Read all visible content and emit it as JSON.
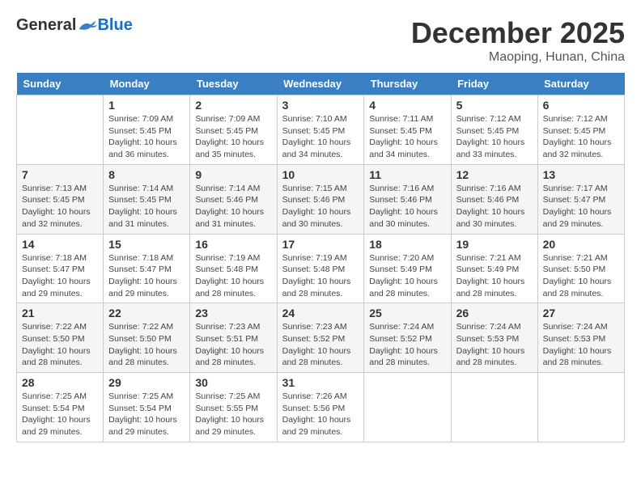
{
  "logo": {
    "general": "General",
    "blue": "Blue"
  },
  "title": {
    "month": "December 2025",
    "location": "Maoping, Hunan, China"
  },
  "weekdays": [
    "Sunday",
    "Monday",
    "Tuesday",
    "Wednesday",
    "Thursday",
    "Friday",
    "Saturday"
  ],
  "weeks": [
    [
      {
        "day": "",
        "sunrise": "",
        "sunset": "",
        "daylight": ""
      },
      {
        "day": "1",
        "sunrise": "Sunrise: 7:09 AM",
        "sunset": "Sunset: 5:45 PM",
        "daylight": "Daylight: 10 hours and 36 minutes."
      },
      {
        "day": "2",
        "sunrise": "Sunrise: 7:09 AM",
        "sunset": "Sunset: 5:45 PM",
        "daylight": "Daylight: 10 hours and 35 minutes."
      },
      {
        "day": "3",
        "sunrise": "Sunrise: 7:10 AM",
        "sunset": "Sunset: 5:45 PM",
        "daylight": "Daylight: 10 hours and 34 minutes."
      },
      {
        "day": "4",
        "sunrise": "Sunrise: 7:11 AM",
        "sunset": "Sunset: 5:45 PM",
        "daylight": "Daylight: 10 hours and 34 minutes."
      },
      {
        "day": "5",
        "sunrise": "Sunrise: 7:12 AM",
        "sunset": "Sunset: 5:45 PM",
        "daylight": "Daylight: 10 hours and 33 minutes."
      },
      {
        "day": "6",
        "sunrise": "Sunrise: 7:12 AM",
        "sunset": "Sunset: 5:45 PM",
        "daylight": "Daylight: 10 hours and 32 minutes."
      }
    ],
    [
      {
        "day": "7",
        "sunrise": "Sunrise: 7:13 AM",
        "sunset": "Sunset: 5:45 PM",
        "daylight": "Daylight: 10 hours and 32 minutes."
      },
      {
        "day": "8",
        "sunrise": "Sunrise: 7:14 AM",
        "sunset": "Sunset: 5:45 PM",
        "daylight": "Daylight: 10 hours and 31 minutes."
      },
      {
        "day": "9",
        "sunrise": "Sunrise: 7:14 AM",
        "sunset": "Sunset: 5:46 PM",
        "daylight": "Daylight: 10 hours and 31 minutes."
      },
      {
        "day": "10",
        "sunrise": "Sunrise: 7:15 AM",
        "sunset": "Sunset: 5:46 PM",
        "daylight": "Daylight: 10 hours and 30 minutes."
      },
      {
        "day": "11",
        "sunrise": "Sunrise: 7:16 AM",
        "sunset": "Sunset: 5:46 PM",
        "daylight": "Daylight: 10 hours and 30 minutes."
      },
      {
        "day": "12",
        "sunrise": "Sunrise: 7:16 AM",
        "sunset": "Sunset: 5:46 PM",
        "daylight": "Daylight: 10 hours and 30 minutes."
      },
      {
        "day": "13",
        "sunrise": "Sunrise: 7:17 AM",
        "sunset": "Sunset: 5:47 PM",
        "daylight": "Daylight: 10 hours and 29 minutes."
      }
    ],
    [
      {
        "day": "14",
        "sunrise": "Sunrise: 7:18 AM",
        "sunset": "Sunset: 5:47 PM",
        "daylight": "Daylight: 10 hours and 29 minutes."
      },
      {
        "day": "15",
        "sunrise": "Sunrise: 7:18 AM",
        "sunset": "Sunset: 5:47 PM",
        "daylight": "Daylight: 10 hours and 29 minutes."
      },
      {
        "day": "16",
        "sunrise": "Sunrise: 7:19 AM",
        "sunset": "Sunset: 5:48 PM",
        "daylight": "Daylight: 10 hours and 28 minutes."
      },
      {
        "day": "17",
        "sunrise": "Sunrise: 7:19 AM",
        "sunset": "Sunset: 5:48 PM",
        "daylight": "Daylight: 10 hours and 28 minutes."
      },
      {
        "day": "18",
        "sunrise": "Sunrise: 7:20 AM",
        "sunset": "Sunset: 5:49 PM",
        "daylight": "Daylight: 10 hours and 28 minutes."
      },
      {
        "day": "19",
        "sunrise": "Sunrise: 7:21 AM",
        "sunset": "Sunset: 5:49 PM",
        "daylight": "Daylight: 10 hours and 28 minutes."
      },
      {
        "day": "20",
        "sunrise": "Sunrise: 7:21 AM",
        "sunset": "Sunset: 5:50 PM",
        "daylight": "Daylight: 10 hours and 28 minutes."
      }
    ],
    [
      {
        "day": "21",
        "sunrise": "Sunrise: 7:22 AM",
        "sunset": "Sunset: 5:50 PM",
        "daylight": "Daylight: 10 hours and 28 minutes."
      },
      {
        "day": "22",
        "sunrise": "Sunrise: 7:22 AM",
        "sunset": "Sunset: 5:50 PM",
        "daylight": "Daylight: 10 hours and 28 minutes."
      },
      {
        "day": "23",
        "sunrise": "Sunrise: 7:23 AM",
        "sunset": "Sunset: 5:51 PM",
        "daylight": "Daylight: 10 hours and 28 minutes."
      },
      {
        "day": "24",
        "sunrise": "Sunrise: 7:23 AM",
        "sunset": "Sunset: 5:52 PM",
        "daylight": "Daylight: 10 hours and 28 minutes."
      },
      {
        "day": "25",
        "sunrise": "Sunrise: 7:24 AM",
        "sunset": "Sunset: 5:52 PM",
        "daylight": "Daylight: 10 hours and 28 minutes."
      },
      {
        "day": "26",
        "sunrise": "Sunrise: 7:24 AM",
        "sunset": "Sunset: 5:53 PM",
        "daylight": "Daylight: 10 hours and 28 minutes."
      },
      {
        "day": "27",
        "sunrise": "Sunrise: 7:24 AM",
        "sunset": "Sunset: 5:53 PM",
        "daylight": "Daylight: 10 hours and 28 minutes."
      }
    ],
    [
      {
        "day": "28",
        "sunrise": "Sunrise: 7:25 AM",
        "sunset": "Sunset: 5:54 PM",
        "daylight": "Daylight: 10 hours and 29 minutes."
      },
      {
        "day": "29",
        "sunrise": "Sunrise: 7:25 AM",
        "sunset": "Sunset: 5:54 PM",
        "daylight": "Daylight: 10 hours and 29 minutes."
      },
      {
        "day": "30",
        "sunrise": "Sunrise: 7:25 AM",
        "sunset": "Sunset: 5:55 PM",
        "daylight": "Daylight: 10 hours and 29 minutes."
      },
      {
        "day": "31",
        "sunrise": "Sunrise: 7:26 AM",
        "sunset": "Sunset: 5:56 PM",
        "daylight": "Daylight: 10 hours and 29 minutes."
      },
      {
        "day": "",
        "sunrise": "",
        "sunset": "",
        "daylight": ""
      },
      {
        "day": "",
        "sunrise": "",
        "sunset": "",
        "daylight": ""
      },
      {
        "day": "",
        "sunrise": "",
        "sunset": "",
        "daylight": ""
      }
    ]
  ]
}
